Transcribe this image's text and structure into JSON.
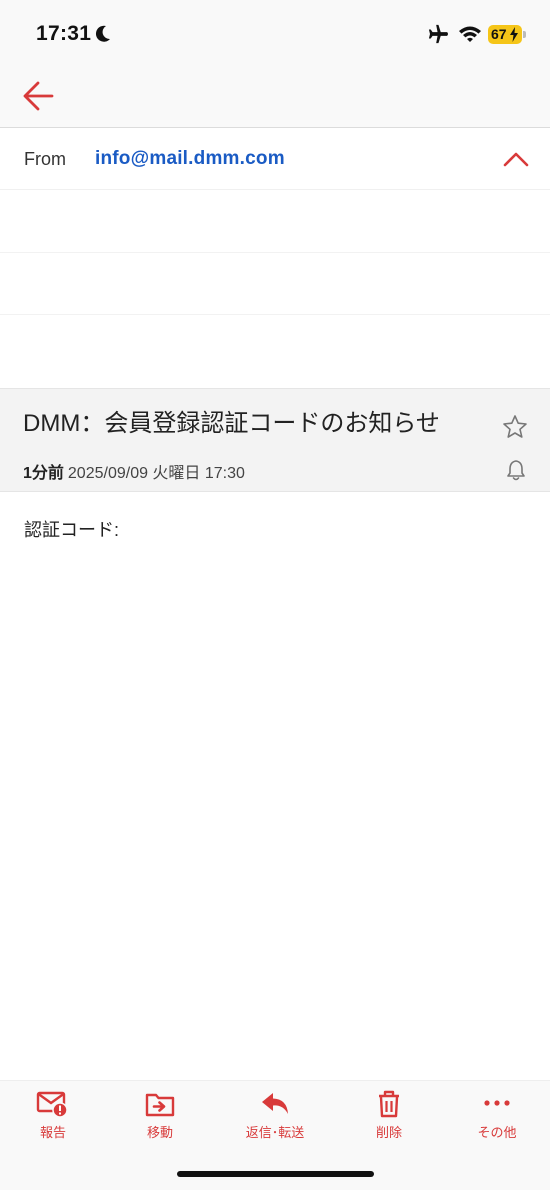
{
  "status_bar": {
    "time": "17:31",
    "battery_level": "67",
    "battery_color": "#f5c518",
    "icons": [
      "moon-icon",
      "airplane-icon",
      "wifi-icon",
      "battery-icon"
    ]
  },
  "nav": {
    "back_icon": "arrow-left-icon"
  },
  "from": {
    "label": "From",
    "address": "info@mail.dmm.com",
    "toggle_icon": "chevron-up-icon"
  },
  "subject": {
    "title": "DMM：会員登録認証コードのお知らせ",
    "age": "1分前",
    "datetime": "2025/09/09 火曜日 17:30",
    "star_icon": "star-outline-icon",
    "bell_icon": "bell-icon"
  },
  "body": {
    "text": "認証コード:"
  },
  "toolbar": {
    "items": [
      {
        "label": "報告",
        "icon": "report-mail-icon"
      },
      {
        "label": "移動",
        "icon": "move-folder-icon"
      },
      {
        "label": "返信･転送",
        "icon": "reply-icon"
      },
      {
        "label": "削除",
        "icon": "trash-icon"
      },
      {
        "label": "その他",
        "icon": "more-dots-icon"
      }
    ]
  },
  "colors": {
    "accent": "#d83a3a",
    "link": "#1a5bc4",
    "subject_bg": "#f3f3f3",
    "bar_bg": "#f9f9f9"
  }
}
